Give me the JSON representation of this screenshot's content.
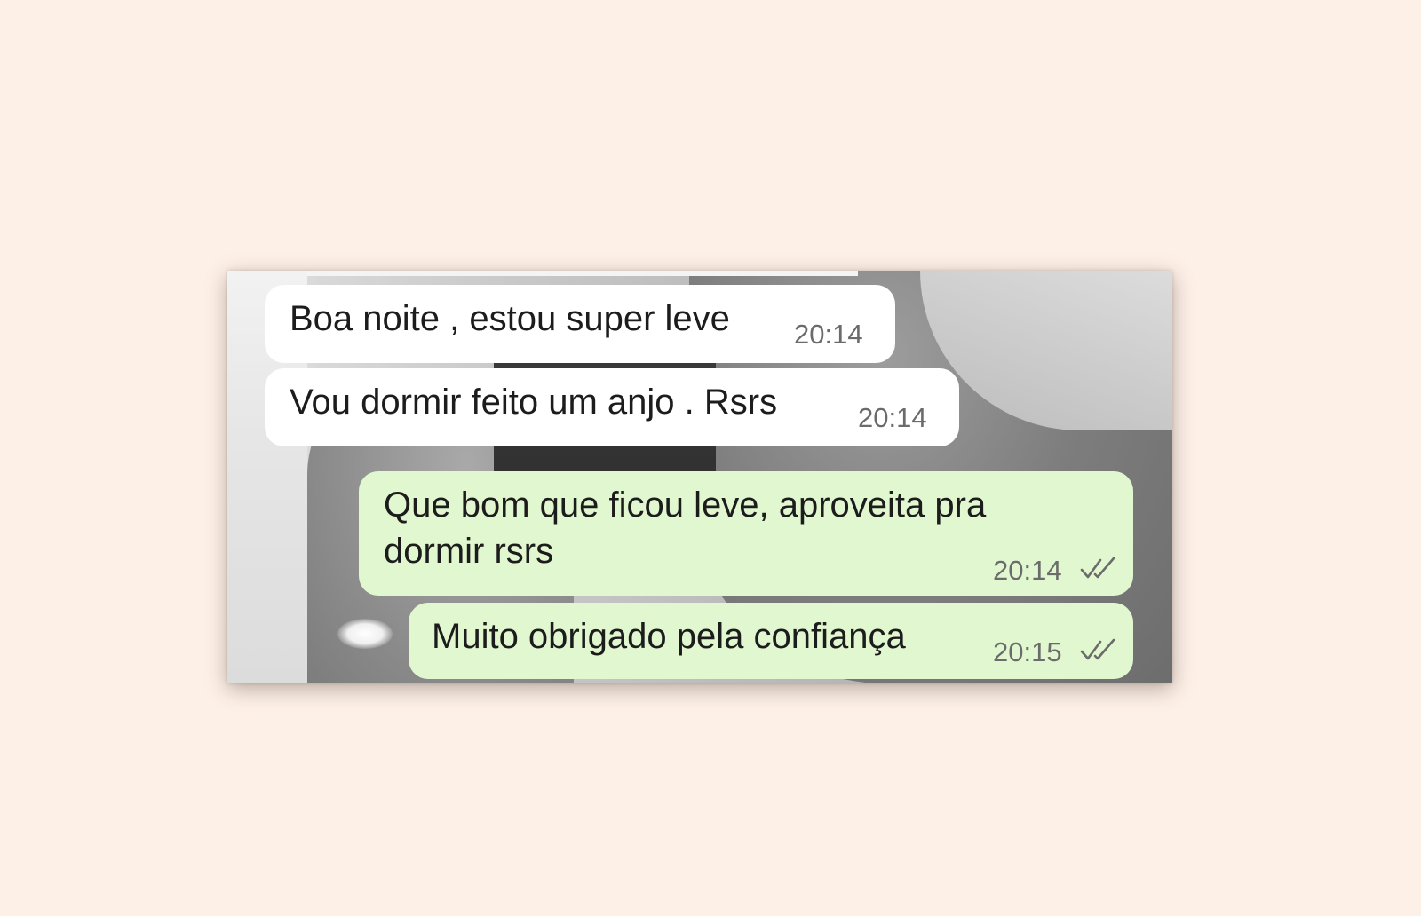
{
  "chat": {
    "messages": [
      {
        "direction": "incoming",
        "text": "Boa noite , estou super leve",
        "time": "20:14"
      },
      {
        "direction": "incoming",
        "text": "Vou dormir feito um anjo . Rsrs",
        "time": "20:14"
      },
      {
        "direction": "outgoing",
        "text_line1": "Que bom que ficou leve, aproveita pra",
        "text_line2": "dormir rsrs",
        "time": "20:14",
        "status_icon": "double-check-icon"
      },
      {
        "direction": "outgoing",
        "text": "Muito obrigado pela confiança",
        "time": "20:15",
        "status_icon": "double-check-icon"
      }
    ]
  },
  "colors": {
    "page_background": "#fdf0e7",
    "incoming_bubble": "#ffffff",
    "outgoing_bubble": "#e1f7cf",
    "message_text": "#1c1c1c",
    "timestamp_text": "#6b6b6b",
    "check_icon": "#6b6b6b"
  }
}
